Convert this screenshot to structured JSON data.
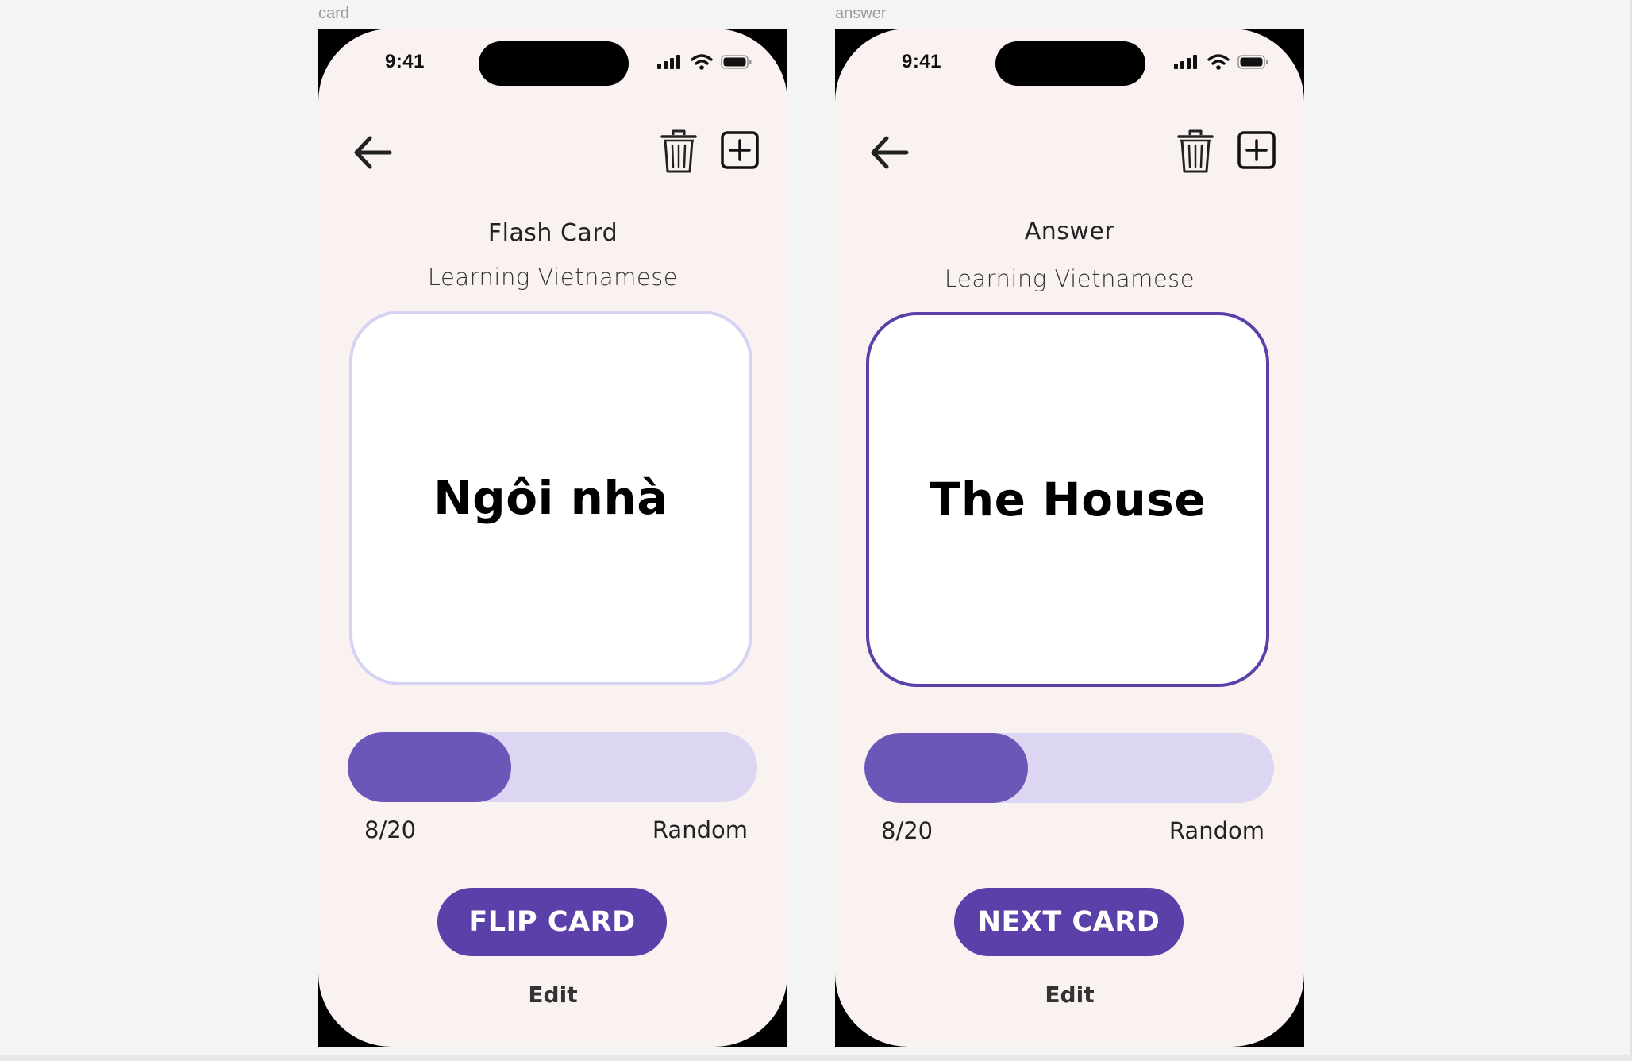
{
  "frames": [
    {
      "label": "card",
      "status": {
        "time": "9:41"
      },
      "title": "Flash Card",
      "subtitle": "Learning Vietnamese",
      "card_text": "Ngôi nhà",
      "progress": {
        "current": 8,
        "total": 20,
        "text": "8/20"
      },
      "random_label": "Random",
      "primary_button": "FLIP CARD",
      "edit_label": "Edit"
    },
    {
      "label": "answer",
      "status": {
        "time": "9:41"
      },
      "title": "Answer",
      "subtitle": "Learning Vietnamese",
      "card_text": "The House",
      "progress": {
        "current": 8,
        "total": 20,
        "text": "8/20"
      },
      "random_label": "Random",
      "primary_button": "NEXT CARD",
      "edit_label": "Edit"
    }
  ],
  "icons": {
    "back": "arrow-left-icon",
    "delete": "trash-icon",
    "add": "plus-square-icon",
    "signal": "signal-icon",
    "wifi": "wifi-icon",
    "battery": "battery-icon"
  },
  "colors": {
    "accent": "#5a40a8",
    "progress_fill": "#6c57b9",
    "progress_track": "#ddd6f2",
    "card_border_question": "#d6d2f5",
    "card_border_answer": "#5a40a8",
    "screen_background": "#faf2f0"
  }
}
